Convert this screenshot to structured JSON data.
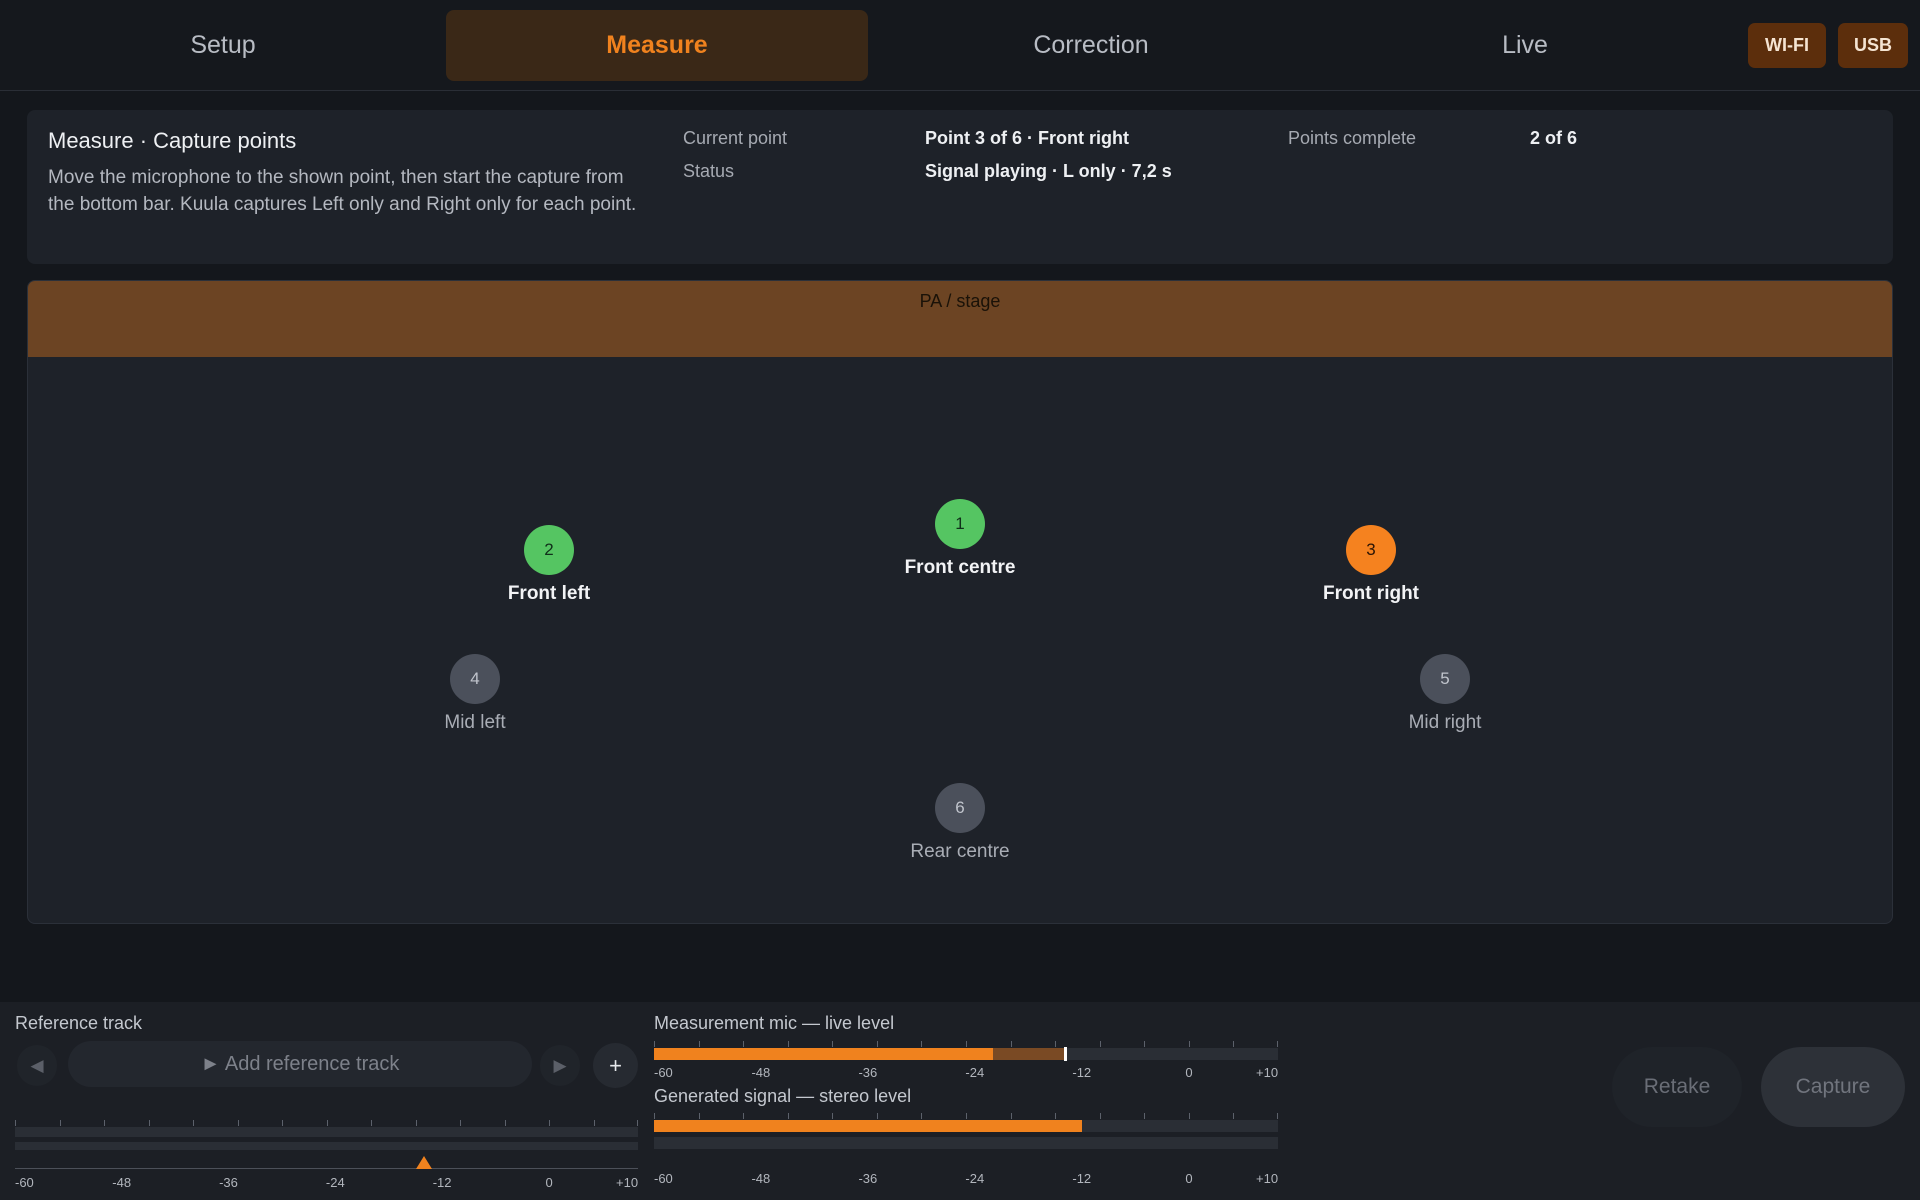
{
  "tabs": [
    {
      "label": "Setup",
      "active": false
    },
    {
      "label": "Measure",
      "active": true
    },
    {
      "label": "Correction",
      "active": false
    },
    {
      "label": "Live",
      "active": false
    }
  ],
  "connections": {
    "wifi": "WI-FI",
    "usb": "USB"
  },
  "info": {
    "title": "Measure · Capture points",
    "description": "Move the microphone to the shown point, then start the capture from the bottom bar. Kuula captures Left only and Right only for each point.",
    "current_point_label": "Current point",
    "current_point_value": "Point 3 of 6 · Front right",
    "status_label": "Status",
    "status_value": "Signal playing · L only · 7,2 s",
    "points_complete_label": "Points complete",
    "points_complete_value": "2 of 6"
  },
  "map": {
    "stage_label": "PA / stage",
    "points": [
      {
        "number": "1",
        "label": "Front centre",
        "state": "done"
      },
      {
        "number": "2",
        "label": "Front left",
        "state": "done"
      },
      {
        "number": "3",
        "label": "Front right",
        "state": "current"
      },
      {
        "number": "4",
        "label": "Mid left",
        "state": "pending"
      },
      {
        "number": "5",
        "label": "Mid right",
        "state": "pending"
      },
      {
        "number": "6",
        "label": "Rear centre",
        "state": "pending"
      }
    ]
  },
  "bottom": {
    "reference": {
      "label": "Reference track",
      "add_label": "► Add reference track",
      "prev_icon": "◀",
      "next_icon": "▶",
      "plus_icon": "+",
      "slider_value_db": -14
    },
    "mic": {
      "label": "Measurement mic — live level",
      "level_db": -22,
      "peak_db": -14
    },
    "signal": {
      "label": "Generated signal — stereo level",
      "level_db": -12
    },
    "scale": [
      "-60",
      "-48",
      "-36",
      "-24",
      "-12",
      "0",
      "+10"
    ],
    "retake_label": "Retake",
    "capture_label": "Capture"
  },
  "colors": {
    "accent": "#f0821e",
    "done": "#55c562",
    "pending": "#4b505b",
    "stage": "#6c4423"
  }
}
